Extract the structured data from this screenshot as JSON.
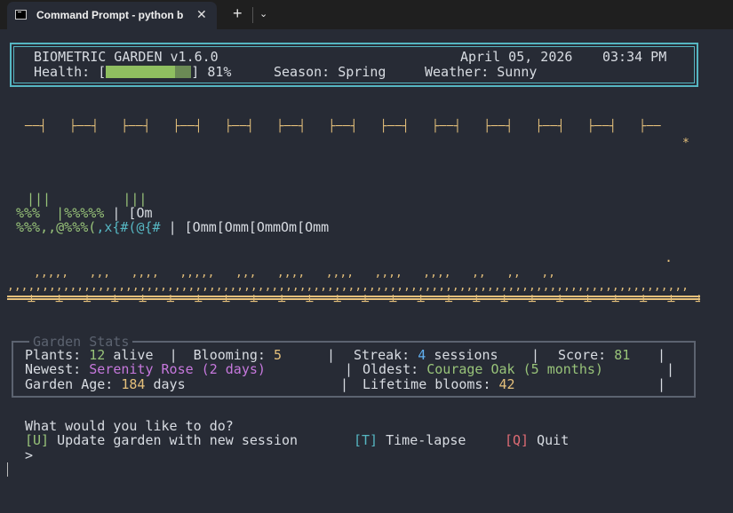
{
  "window": {
    "tab_title": "Command Prompt - python b",
    "new_tab": "+",
    "close": "✕",
    "dropdown": "⌄"
  },
  "header": {
    "app_title": "BIOMETRIC GARDEN v1.6.0",
    "date": "April 05, 2026",
    "time": "03:34 PM",
    "health_label": "Health: [",
    "health_close": "]",
    "health_value": "81%",
    "season_label": "Season:",
    "season_value": "Spring",
    "weather_label": "Weather:",
    "weather_value": "Sunny",
    "health_fraction": 0.81
  },
  "garden": {
    "sky_row": "──┤   ├──┤   ├──┤   ├──┤   ├──┤   ├──┤   ├──┤   ├──┤   ├──┤   ├──┤   ├──┤   ├──┤   ├──",
    "star": "*",
    "plant_row1": "|||         |||",
    "plant_row2_a": "%%%  |%%%%%",
    "plant_row2_b": " | [Om",
    "plant_row3_a": "%%%,,@%%%(",
    "plant_row3_b": ",x{#(@{#",
    "plant_row3_c": " | [Omm[Omm[OmmOm[Omm",
    "dot": ".",
    "grass_row1": ",,,,,   ,,,   ,,,,   ,,,,,   ,,,   ,,,,   ,,,,   ,,,,   ,,,,   ,,   ,,   ,,",
    "grass_row2": ",,,,,,,,,,,,,,,,,,,,,,,,,,,,,,,,,,,,,,,,,,,,,,,,,,,,,,,,,,,,,,,,,,,,,,,,,,,,,,,,,,,,,,,,,,,,,,,,,,",
    "rail_ticks": "   ┴   ┴   ┴   ┴   ┴   ┴   ┴   ┴   ┴   ┴   ┴   ┴   ┴   ┴   ┴   ┴   ┴   ┴   ┴   ┴   ┴   ┴   ┴   ┴   ┴"
  },
  "stats": {
    "legend": "Garden Stats",
    "plants_label": "Plants:",
    "plants_value": "12",
    "plants_unit": "alive",
    "blooming_label": "Blooming:",
    "blooming_value": "5",
    "streak_label": "Streak:",
    "streak_value": "4",
    "streak_unit": "sessions",
    "score_label": "Score:",
    "score_value": "81",
    "newest_label": "Newest:",
    "newest_value": "Serenity Rose (2 days)",
    "oldest_label": "Oldest:",
    "oldest_value": "Courage Oak (5 months)",
    "age_label": "Garden Age:",
    "age_value": "184",
    "age_unit": "days",
    "lifetime_label": "Lifetime blooms:",
    "lifetime_value": "42",
    "pipe": "|"
  },
  "menu": {
    "prompt": "What would you like to do?",
    "u_key": "[U]",
    "u_label": "Update garden with new session",
    "t_key": "[T]",
    "t_label": "Time-lapse",
    "q_key": "[Q]",
    "q_label": "Quit",
    "input_prompt": ">"
  }
}
